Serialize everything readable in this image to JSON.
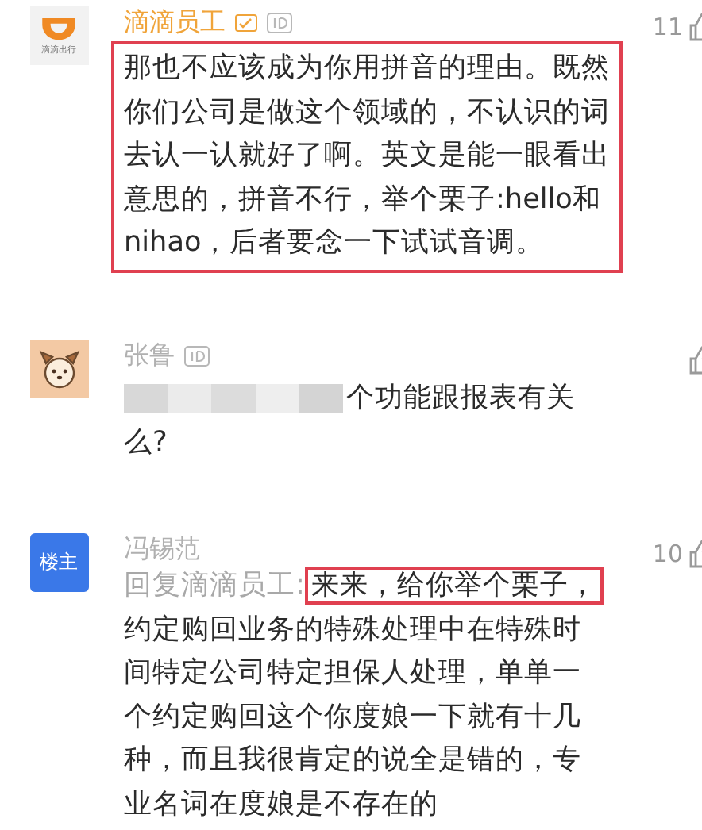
{
  "comments": [
    {
      "avatar": {
        "kind": "logo",
        "caption": "滴滴出行"
      },
      "name": "滴滴员工",
      "color": "#f0a43a",
      "verified": true,
      "likes": "11",
      "parts": [
        {
          "kind": "text",
          "text": "那也不应该成为你用拼音的理由。既然你们公司是做这个领域的，不认识的词去认一认就好了啊。英文是能一眼看出意思的，拼音不行，举个栗子:hello和nihao，后者要念一下试试音调。"
        }
      ],
      "highlighted": true,
      "redacted": false
    },
    {
      "avatar": {
        "kind": "dog"
      },
      "name": "张鲁",
      "color": "#b0b0b0",
      "verified": false,
      "parts": [
        {
          "kind": "text",
          "text": "个功能跟报表有关么?"
        }
      ],
      "highlighted": false,
      "redacted": true
    },
    {
      "avatar": {
        "kind": "label",
        "label": "楼主"
      },
      "name": "冯锡范",
      "color": "#b0b0b0",
      "verified": false,
      "likes": "10",
      "parts": [
        {
          "kind": "reply",
          "text": "回复滴滴员工:"
        },
        {
          "kind": "highlight",
          "text": "来来，给你举个栗子，"
        },
        {
          "kind": "text",
          "text": "约定购回业务的特殊处理中在特殊时间特定公司特定担保人处理，单单一个约定购回这个你度娘一下就有十几种，而且我很肯定的说全是错的，专业名词在度娘是不存在的"
        }
      ],
      "highlighted": false,
      "redacted": false,
      "show_id": false
    }
  ]
}
